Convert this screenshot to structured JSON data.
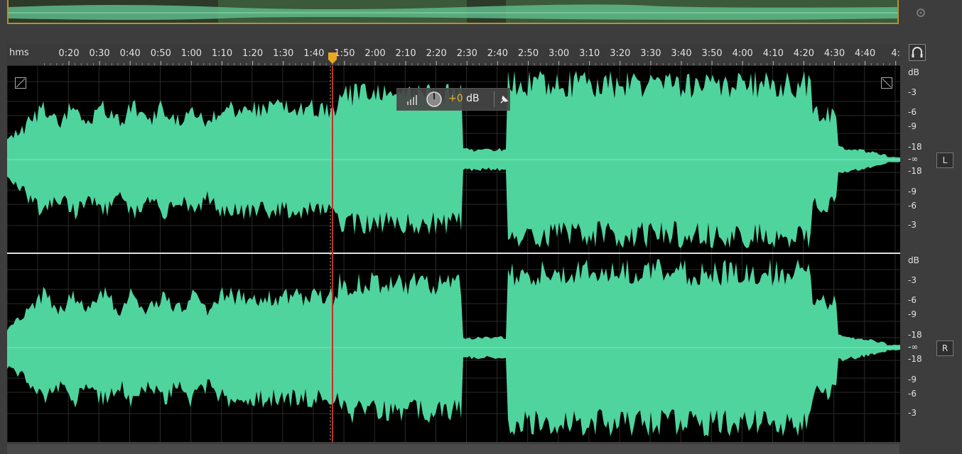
{
  "ruler": {
    "unit": "hms",
    "ticks": [
      "0:20",
      "0:30",
      "0:40",
      "0:50",
      "1:00",
      "1:10",
      "1:20",
      "1:30",
      "1:40",
      "1:50",
      "2:00",
      "2:10",
      "2:20",
      "2:30",
      "2:40",
      "2:50",
      "3:00",
      "3:10",
      "3:20",
      "3:30",
      "3:40",
      "3:50",
      "4:00",
      "4:10",
      "4:20",
      "4:30",
      "4:40",
      "4:"
    ]
  },
  "db_scale": {
    "left": [
      "dB",
      "-3",
      "-6",
      "-9",
      "-18",
      "-∞",
      "-18",
      "-9",
      "-6",
      "-3"
    ],
    "right": [
      "dB",
      "-3",
      "-6",
      "-9",
      "-18",
      "-∞",
      "-18",
      "-9",
      "-6",
      "-3"
    ]
  },
  "channels": {
    "left": "L",
    "right": "R"
  },
  "hud": {
    "value": "+0",
    "unit": " dB"
  },
  "playhead": {
    "time": "1:41"
  },
  "colors": {
    "waveform": "#4fd49e",
    "overview_border": "#b8902e",
    "playhead": "#e8a820"
  }
}
